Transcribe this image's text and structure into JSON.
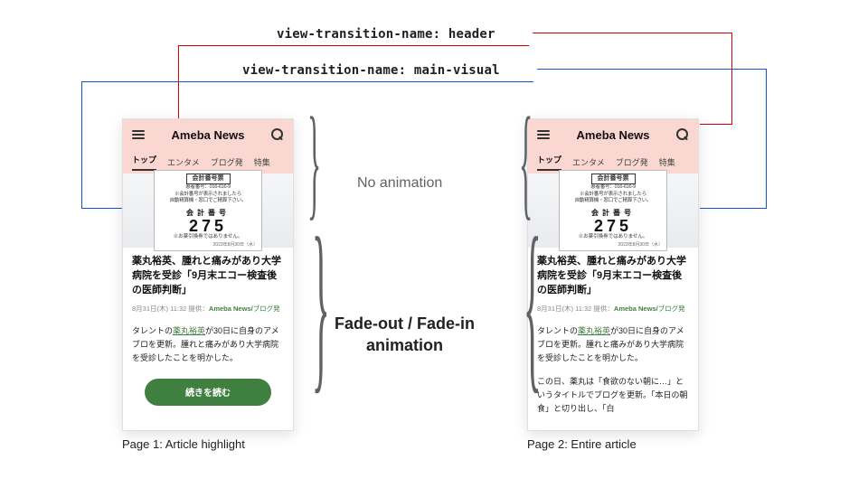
{
  "labels": {
    "vt_header": "view-transition-name: header",
    "vt_main_visual": "view-transition-name: main-visual",
    "no_animation": "No animation",
    "fade_line1": "Fade-out / Fade-in",
    "fade_line2": "animation",
    "caption_left": "Page 1: Article highlight",
    "caption_right": "Page 2: Entire article"
  },
  "colors": {
    "red": "#d80000",
    "blue": "#1155cc",
    "header_bg": "#fad7d1",
    "cta_green": "#3f7f3f"
  },
  "phone": {
    "brand": "Ameba News",
    "tabs": [
      "トップ",
      "エンタメ",
      "ブログ発",
      "特集"
    ],
    "active_tab_index": 0,
    "ticket": {
      "title": "会計番号票",
      "sub1": "患者番号：016-616-9",
      "sub2": "※会計番号が表示されましたら",
      "sub3": "自動精算機・窓口でご精算下さい。",
      "num_label": "会計番号",
      "number": "275",
      "note": "※お薬引換券ではありません。",
      "date": "2023年8月30日（水）"
    },
    "article": {
      "title": "薬丸裕英、腫れと痛みがあり大学病院を受診「9月末エコー検査後の医師判断」",
      "meta_datetime": "8月31日(木) 11:32",
      "meta_provider": "提供：",
      "meta_source": "Ameba News/",
      "meta_source_sub": "ブログ発",
      "body_prefix": "タレントの",
      "body_link": "薬丸裕英",
      "body_after": "が30日に自身のアメブロを更新。腫れと痛みがあり大学病院を受診したことを明かした。",
      "cta": "続きを読む",
      "extra_para": "この日、薬丸は「食欲のない朝に…」というタイトルでブログを更新。「本日の朝食」と切り出し、「白"
    }
  }
}
